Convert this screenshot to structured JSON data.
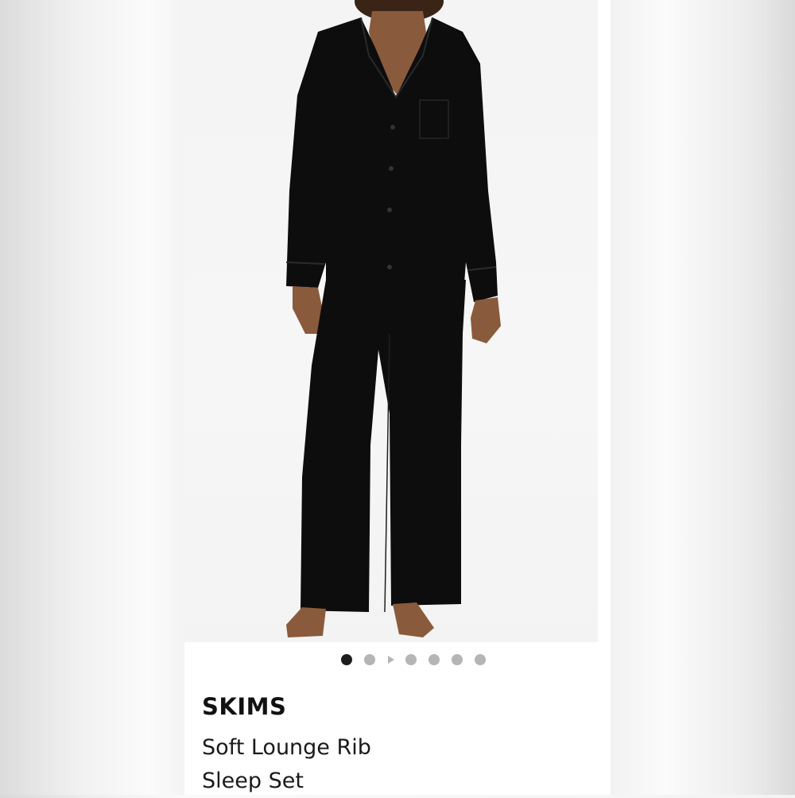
{
  "product": {
    "brand": "SKIMS",
    "name_line1": "Soft Lounge Rib",
    "name_line2": "Sleep Set"
  },
  "image_carousel": {
    "total_images": 7,
    "active_index": 0,
    "video_marker_after_index": 1
  },
  "colors": {
    "garment": "#0d0d0d",
    "active_dot": "#1c1c1c",
    "inactive_dot": "#b5b5b5",
    "card_background": "#ffffff"
  }
}
